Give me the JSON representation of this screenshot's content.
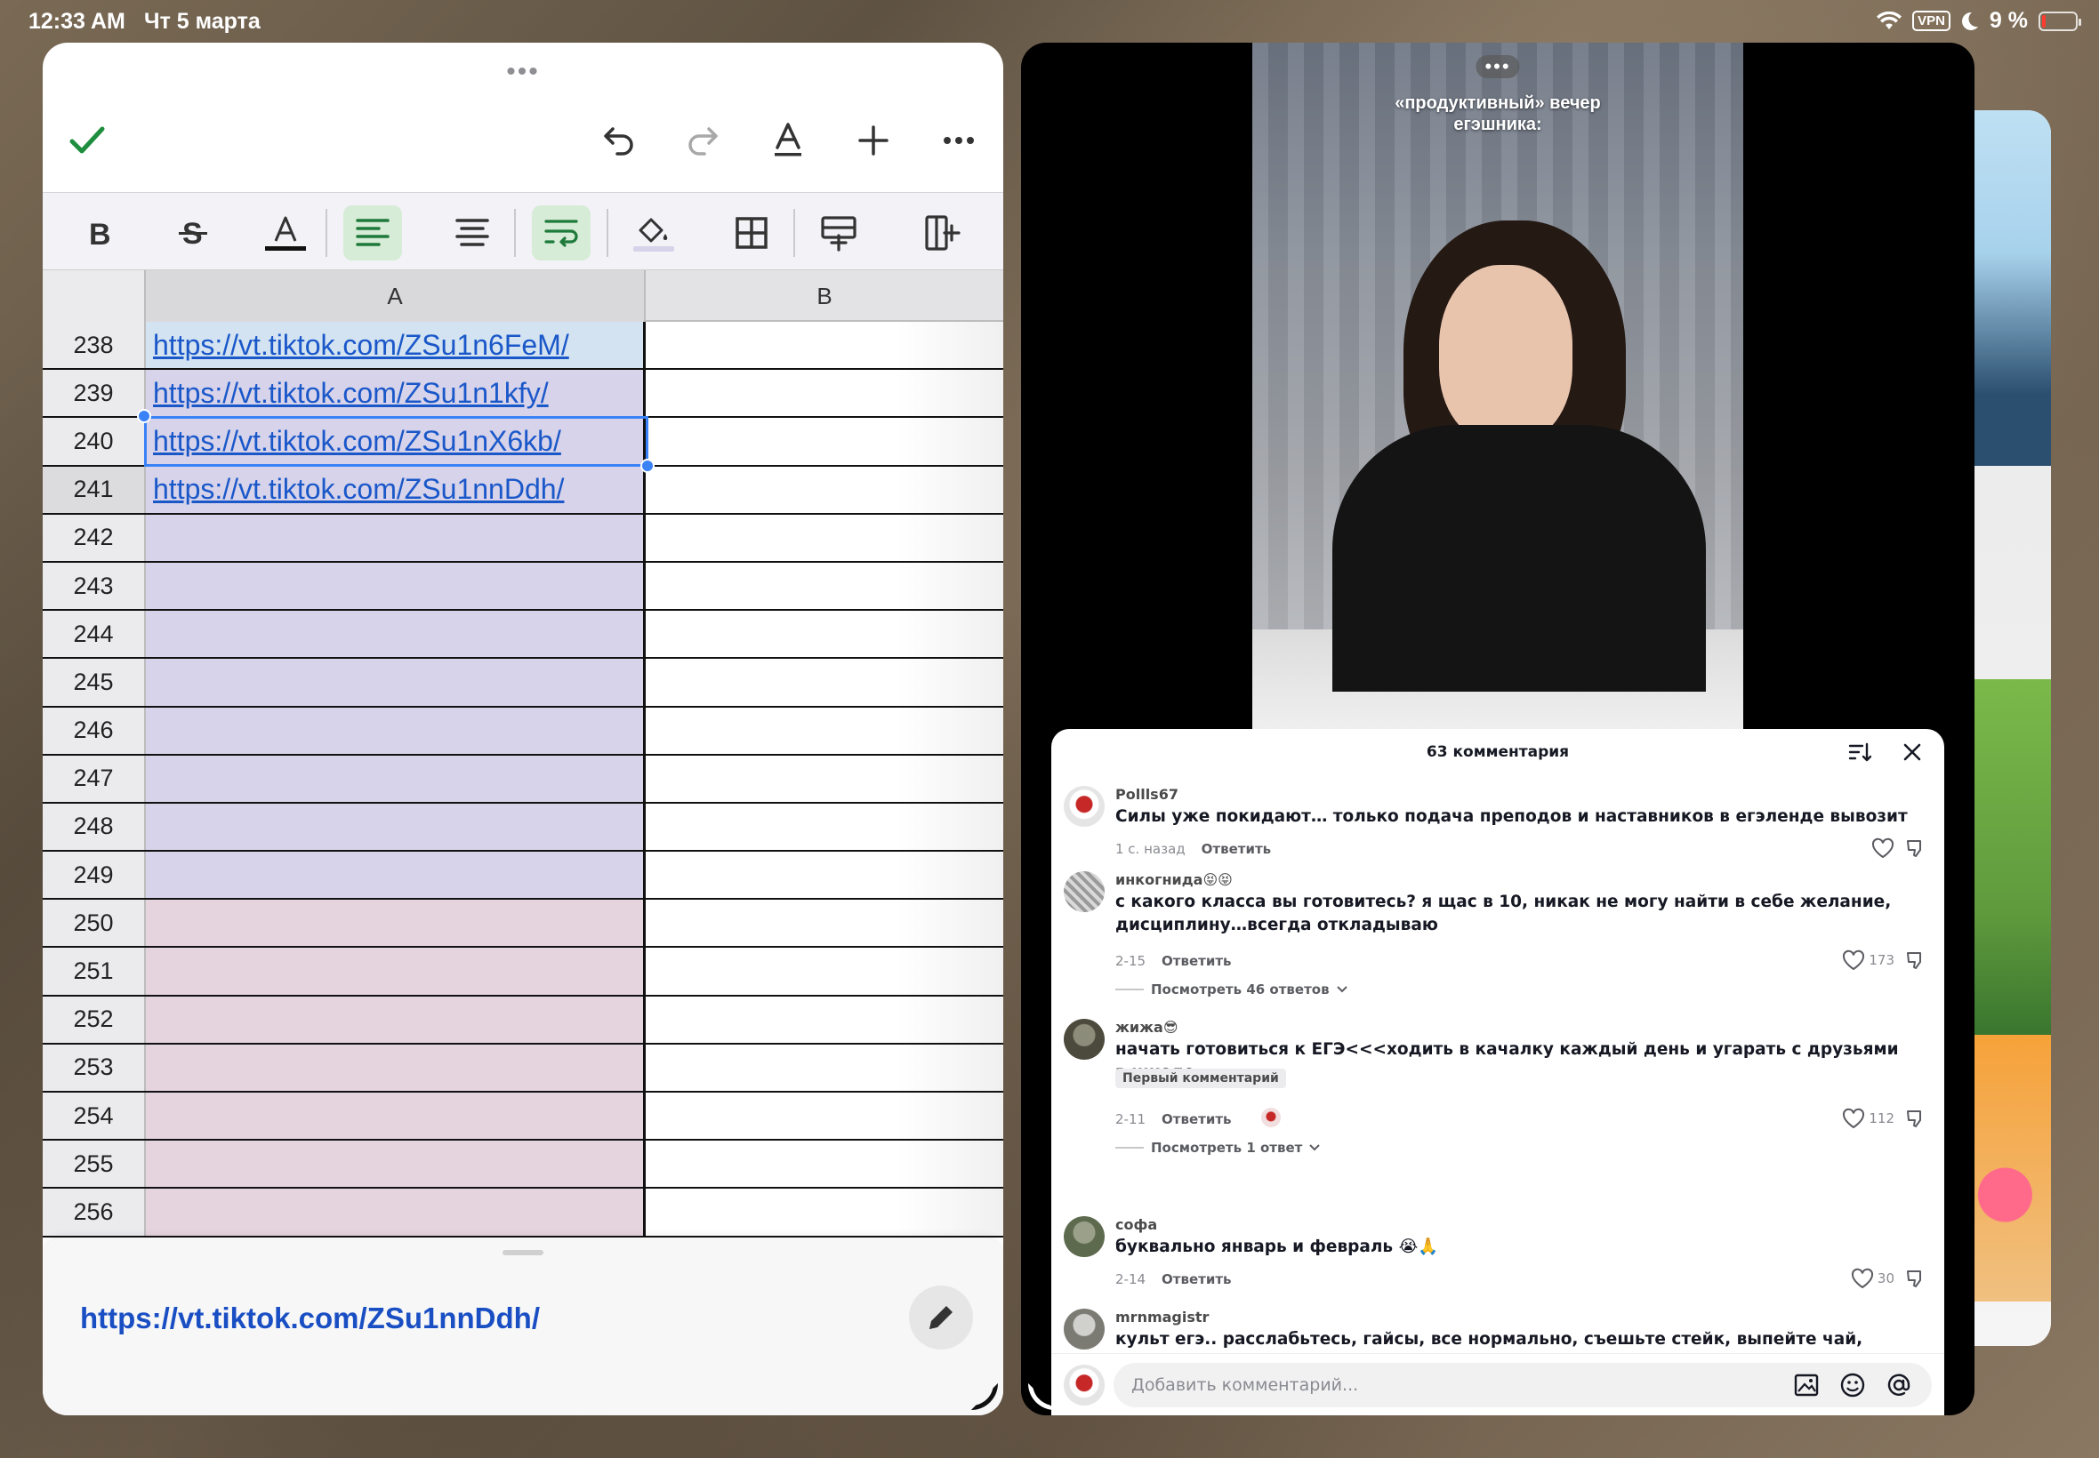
{
  "status": {
    "time": "12:33 AM",
    "date": "Чт 5 марта",
    "vpn": "VPN",
    "battery": "9 %"
  },
  "sheet": {
    "columns": [
      "A",
      "B"
    ],
    "rows": [
      {
        "num": "238",
        "a": "https://vt.tiktok.com/ZSu1n6FeM/",
        "fill": "sel-hl"
      },
      {
        "num": "239",
        "a": "https://vt.tiktok.com/ZSu1n1kfy/",
        "fill": "violet"
      },
      {
        "num": "240",
        "a": "https://vt.tiktok.com/ZSu1nX6kb/",
        "fill": "violet"
      },
      {
        "num": "241",
        "a": "https://vt.tiktok.com/ZSu1nnDdh/",
        "fill": "violet"
      },
      {
        "num": "242",
        "a": "",
        "fill": "violet"
      },
      {
        "num": "243",
        "a": "",
        "fill": "violet"
      },
      {
        "num": "244",
        "a": "",
        "fill": "violet"
      },
      {
        "num": "245",
        "a": "",
        "fill": "violet"
      },
      {
        "num": "246",
        "a": "",
        "fill": "violet"
      },
      {
        "num": "247",
        "a": "",
        "fill": "violet"
      },
      {
        "num": "248",
        "a": "",
        "fill": "violet"
      },
      {
        "num": "249",
        "a": "",
        "fill": "violet"
      },
      {
        "num": "250",
        "a": "",
        "fill": "pink"
      },
      {
        "num": "251",
        "a": "",
        "fill": "pink"
      },
      {
        "num": "252",
        "a": "",
        "fill": "pink"
      },
      {
        "num": "253",
        "a": "",
        "fill": "pink"
      },
      {
        "num": "254",
        "a": "",
        "fill": "pink"
      },
      {
        "num": "255",
        "a": "",
        "fill": "pink"
      },
      {
        "num": "256",
        "a": "",
        "fill": "pink"
      }
    ],
    "editor_value": "https://vt.tiktok.com/ZSu1nnDdh/"
  },
  "video": {
    "caption_line1": "«продуктивный» вечер",
    "caption_line2": "егэшника:"
  },
  "comments": {
    "header": "63 комментария",
    "items": [
      {
        "user": "Pollls67",
        "text": "Силы уже покидают… только подача преподов и наставников в егэленде вывозит",
        "date": "1 с. назад",
        "reply": "Ответить",
        "likes": ""
      },
      {
        "user": "инкогнида😝😝",
        "text": "с какого класса вы готовитесь? я щас в 10, никак не могу найти в себе желание, дисциплину…всегда откладываю",
        "date": "2-15",
        "reply": "Ответить",
        "likes": "173",
        "more": "Посмотреть 46 ответов"
      },
      {
        "user": "жижа😎",
        "text": "начать готовиться к ЕГЭ<<<ходить в качалку каждый день и угарать с друзьями в школе",
        "badge": "Первый комментарий",
        "date": "2-11",
        "reply": "Ответить",
        "likes": "112",
        "more": "Посмотреть 1 ответ"
      },
      {
        "user": "софа",
        "text": "буквально январь и февраль 😭🙏",
        "date": "2-14",
        "reply": "Ответить",
        "likes": "30"
      },
      {
        "user": "mrnmagistr",
        "text": "культ егэ.. расслабьтесь, гайсы, все нормально, съешьте стейк, выпейте чай, сходите в зал, все кайф будет и так"
      }
    ],
    "input_placeholder": "Добавить комментарий..."
  }
}
